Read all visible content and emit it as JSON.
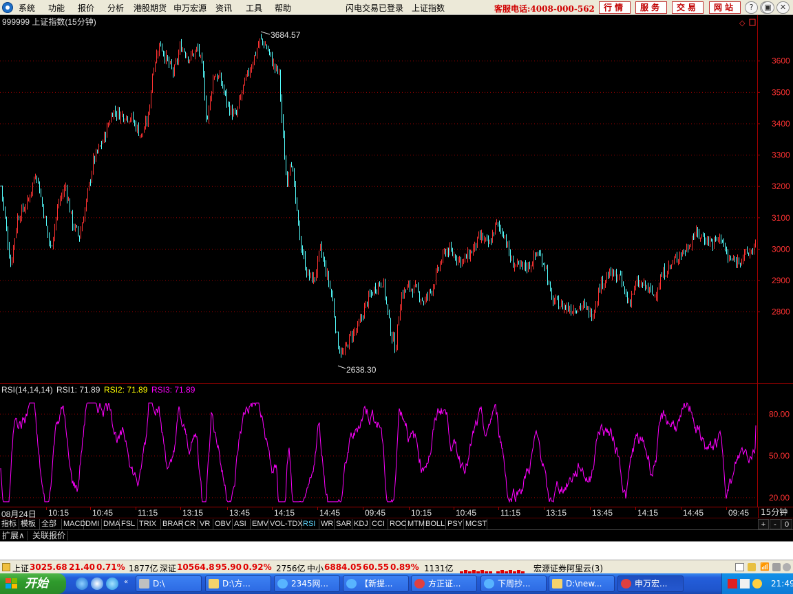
{
  "menu": {
    "items": [
      "系统",
      "功能",
      "报价",
      "分析",
      "港股期货",
      "申万宏源",
      "资讯",
      "工具",
      "帮助"
    ],
    "login_status": "闪电交易已登录",
    "current_index": "上证指数",
    "hotline": "客服电话:4008-000-562",
    "top_buttons": [
      "行情",
      "服务",
      "交易",
      "网站"
    ],
    "window_buttons": [
      "?",
      "−",
      "▣",
      "✕"
    ]
  },
  "chart": {
    "title": "999999 上证指数(15分钟)",
    "colors": {
      "up": "#ff3232",
      "down": "#54ffff",
      "rsi": "#ff00ff",
      "grid": "#a00000",
      "axis_text": "#ff3232",
      "rsi_label1": "#e0e0e0",
      "rsi_label2": "#ffff00",
      "rsi_label3": "#ff00ff"
    },
    "max_marker": "3684.57",
    "min_marker": "2638.30",
    "rsi": {
      "label": "RSI(14,14,14)",
      "rsi1": "RSI1: 71.89",
      "rsi2": "RSI2: 71.89",
      "rsi3": "RSI3: 71.89"
    }
  },
  "chart_data": [
    {
      "type": "candlestick",
      "title": "999999 上证指数(15分钟)",
      "ylim": [
        2580,
        3720
      ],
      "y_ticks": [
        "3600",
        "3500",
        "3400",
        "3300",
        "3200",
        "3100",
        "3000",
        "2900",
        "2800"
      ],
      "x_ticks": [
        "08月24日",
        "10:15",
        "10:45",
        "11:15",
        "13:15",
        "13:45",
        "14:15",
        "14:45",
        "09:45",
        "10:15",
        "10:45",
        "11:15",
        "13:15",
        "13:45",
        "14:15",
        "14:45",
        "09:45"
      ],
      "annotations": [
        {
          "label": "3684.57",
          "value": 3684.57,
          "type": "max"
        },
        {
          "label": "2638.30",
          "value": 2638.3,
          "type": "min"
        }
      ],
      "close_path": [
        [
          0,
          3220
        ],
        [
          15,
          2950
        ],
        [
          25,
          3100
        ],
        [
          40,
          3150
        ],
        [
          52,
          3250
        ],
        [
          62,
          3130
        ],
        [
          73,
          3000
        ],
        [
          85,
          3150
        ],
        [
          95,
          3200
        ],
        [
          105,
          3080
        ],
        [
          115,
          3040
        ],
        [
          125,
          3150
        ],
        [
          135,
          3280
        ],
        [
          150,
          3350
        ],
        [
          163,
          3440
        ],
        [
          175,
          3430
        ],
        [
          190,
          3420
        ],
        [
          205,
          3360
        ],
        [
          215,
          3420
        ],
        [
          222,
          3580
        ],
        [
          232,
          3660
        ],
        [
          242,
          3600
        ],
        [
          252,
          3560
        ],
        [
          262,
          3650
        ],
        [
          275,
          3610
        ],
        [
          288,
          3640
        ],
        [
          295,
          3550
        ],
        [
          300,
          3400
        ],
        [
          310,
          3560
        ],
        [
          320,
          3540
        ],
        [
          332,
          3450
        ],
        [
          342,
          3420
        ],
        [
          352,
          3510
        ],
        [
          365,
          3590
        ],
        [
          378,
          3670
        ],
        [
          388,
          3640
        ],
        [
          398,
          3580
        ],
        [
          405,
          3560
        ],
        [
          410,
          3380
        ],
        [
          416,
          3210
        ],
        [
          422,
          3300
        ],
        [
          430,
          3130
        ],
        [
          436,
          3020
        ],
        [
          446,
          2920
        ],
        [
          456,
          2900
        ],
        [
          465,
          3000
        ],
        [
          474,
          2920
        ],
        [
          482,
          2850
        ],
        [
          490,
          2700
        ],
        [
          498,
          2660
        ],
        [
          508,
          2720
        ],
        [
          520,
          2750
        ],
        [
          532,
          2830
        ],
        [
          545,
          2880
        ],
        [
          556,
          2900
        ],
        [
          566,
          2750
        ],
        [
          574,
          2680
        ],
        [
          582,
          2850
        ],
        [
          592,
          2880
        ],
        [
          604,
          2870
        ],
        [
          616,
          2830
        ],
        [
          628,
          2880
        ],
        [
          640,
          2960
        ],
        [
          648,
          3000
        ],
        [
          660,
          2980
        ],
        [
          672,
          2960
        ],
        [
          684,
          2990
        ],
        [
          698,
          3040
        ],
        [
          710,
          3010
        ],
        [
          720,
          3080
        ],
        [
          732,
          3050
        ],
        [
          742,
          2960
        ],
        [
          755,
          2940
        ],
        [
          770,
          2950
        ],
        [
          780,
          2990
        ],
        [
          792,
          2950
        ],
        [
          800,
          2840
        ],
        [
          815,
          2820
        ],
        [
          830,
          2810
        ],
        [
          845,
          2820
        ],
        [
          860,
          2790
        ],
        [
          872,
          2890
        ],
        [
          885,
          2920
        ],
        [
          900,
          2910
        ],
        [
          912,
          2830
        ],
        [
          925,
          2890
        ],
        [
          938,
          2880
        ],
        [
          950,
          2850
        ],
        [
          962,
          2920
        ],
        [
          975,
          2950
        ],
        [
          985,
          2980
        ],
        [
          997,
          3000
        ],
        [
          1008,
          3050
        ],
        [
          1020,
          3040
        ],
        [
          1035,
          3020
        ],
        [
          1048,
          3040
        ],
        [
          1056,
          2970
        ],
        [
          1068,
          2960
        ],
        [
          1080,
          2980
        ],
        [
          1090,
          2990
        ],
        [
          1098,
          3020
        ]
      ]
    },
    {
      "type": "line",
      "title": "RSI(14,14,14)",
      "ylim": [
        15,
        90
      ],
      "y_ticks": [
        "80.00",
        "50.00",
        "20.00"
      ],
      "series": [
        {
          "name": "RSI1",
          "last": 71.89
        },
        {
          "name": "RSI2",
          "last": 71.89
        },
        {
          "name": "RSI3",
          "last": 71.89
        }
      ]
    }
  ],
  "period": "15分钟",
  "indicator_tabs": [
    "指标",
    "模板",
    "全部",
    "MACD",
    "DMI",
    "DMA",
    "FSL",
    "TRIX",
    "BRAR",
    "CR",
    "VR",
    "OBV",
    "ASI",
    "EMV",
    "VOL-TDX",
    "RSI",
    "WR",
    "SAR",
    "KDJ",
    "CCI",
    "ROC",
    "MTM",
    "BOLL",
    "PSY",
    "MCST"
  ],
  "active_tab": "RSI",
  "tab_controls": [
    "+",
    "-",
    "0"
  ],
  "ext_tabs": [
    "扩展∧",
    "关联报价"
  ],
  "statusbar": {
    "sh_label": "上证",
    "sh_value": "3025.68",
    "sh_change": "21.40",
    "sh_pct": "0.71%",
    "sh_amount": "1877亿",
    "sz_label": "深证",
    "sz_value": "10564.8",
    "sz_change": "95.90",
    "sz_pct": "0.92%",
    "sz_amount": "2756亿",
    "zx_label": "中小",
    "zx_value": "6884.05",
    "zx_change": "60.55",
    "zx_pct": "0.89%",
    "zx_amount": "1131亿",
    "broker": "宏源证券阿里云(3)"
  },
  "taskbar": {
    "start": "开始",
    "tasks": [
      {
        "label": "D:\\",
        "icon": "drive-icon"
      },
      {
        "label": "D:\\方...",
        "icon": "folder-icon"
      },
      {
        "label": "2345网...",
        "icon": "ie-icon"
      },
      {
        "label": "【新提...",
        "icon": "ie-icon"
      },
      {
        "label": "方正证...",
        "icon": "app-icon"
      },
      {
        "label": "下周抄...",
        "icon": "ie-icon"
      },
      {
        "label": "D:\\new...",
        "icon": "folder-icon"
      },
      {
        "label": "申万宏...",
        "icon": "app-icon"
      }
    ],
    "clock": "21:49"
  }
}
